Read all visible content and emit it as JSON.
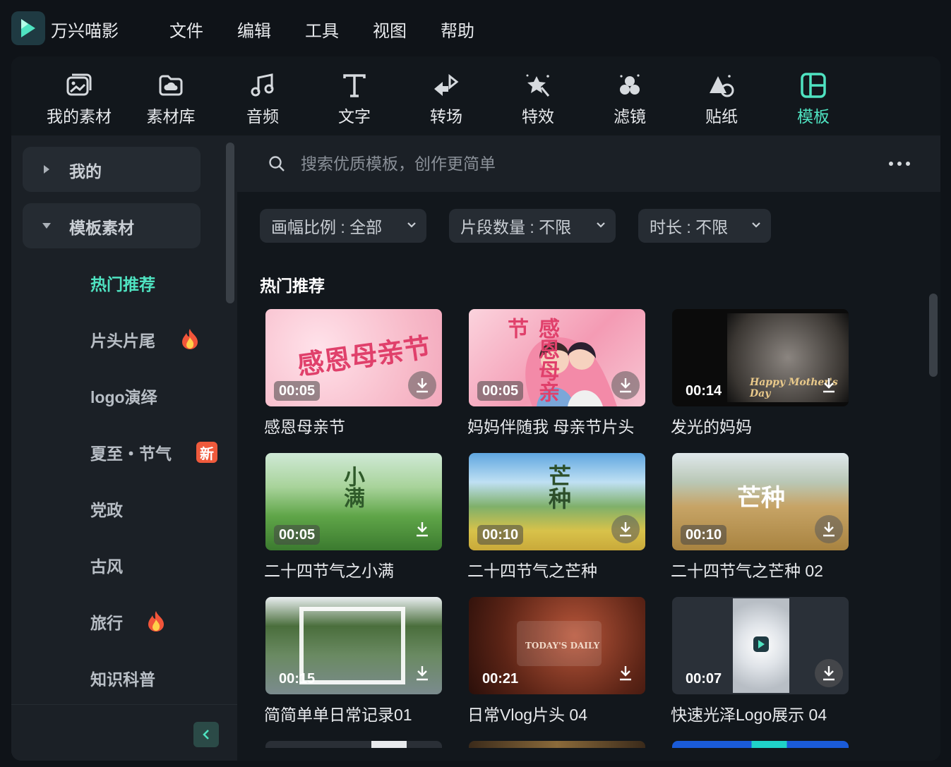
{
  "app": {
    "name": "万兴喵影"
  },
  "menu": [
    "文件",
    "编辑",
    "工具",
    "视图",
    "帮助"
  ],
  "toolbar": [
    {
      "label": "我的素材",
      "icon": "my-media-icon"
    },
    {
      "label": "素材库",
      "icon": "stock-media-icon"
    },
    {
      "label": "音频",
      "icon": "audio-icon"
    },
    {
      "label": "文字",
      "icon": "text-icon"
    },
    {
      "label": "转场",
      "icon": "transition-icon"
    },
    {
      "label": "特效",
      "icon": "effects-icon"
    },
    {
      "label": "滤镜",
      "icon": "filter-icon"
    },
    {
      "label": "贴纸",
      "icon": "sticker-icon"
    },
    {
      "label": "模板",
      "icon": "template-icon",
      "active": true
    }
  ],
  "accent": "#4fe3c1",
  "sidebar": {
    "groups": [
      {
        "label": "我的",
        "expanded": false
      },
      {
        "label": "模板素材",
        "expanded": true
      }
    ],
    "items": [
      {
        "label": "热门推荐",
        "active": true
      },
      {
        "label": "片头片尾",
        "badge": "hot"
      },
      {
        "label": "logo演绎"
      },
      {
        "label": "夏至・节气",
        "badge": "新"
      },
      {
        "label": "党政"
      },
      {
        "label": "古风"
      },
      {
        "label": "旅行",
        "badge": "hot"
      },
      {
        "label": "知识科普"
      }
    ]
  },
  "search": {
    "placeholder": "搜索优质模板，创作更简单"
  },
  "filters": [
    {
      "label": "画幅比例 : 全部"
    },
    {
      "label": "片段数量 : 不限"
    },
    {
      "label": "时长 : 不限"
    }
  ],
  "section": {
    "title": "热门推荐"
  },
  "templates": [
    {
      "title": "感恩母亲节",
      "duration": "00:05",
      "art": "感恩母亲节"
    },
    {
      "title": "妈妈伴随我 母亲节片头",
      "duration": "00:05",
      "art": "感恩母亲节"
    },
    {
      "title": "发光的妈妈",
      "duration": "00:14",
      "art": "Happy Mother's Day"
    },
    {
      "title": "二十四节气之小满",
      "duration": "00:05",
      "art": "小满"
    },
    {
      "title": "二十四节气之芒种",
      "duration": "00:10",
      "art": "芒种"
    },
    {
      "title": "二十四节气之芒种 02",
      "duration": "00:10",
      "art": "芒种"
    },
    {
      "title": "简简单单日常记录01",
      "duration": "00:15",
      "art": ""
    },
    {
      "title": "日常Vlog片头 04",
      "duration": "00:21",
      "art": "TODAY'S DAILY"
    },
    {
      "title": "快速光泽Logo展示 04",
      "duration": "00:07",
      "art": ""
    }
  ]
}
